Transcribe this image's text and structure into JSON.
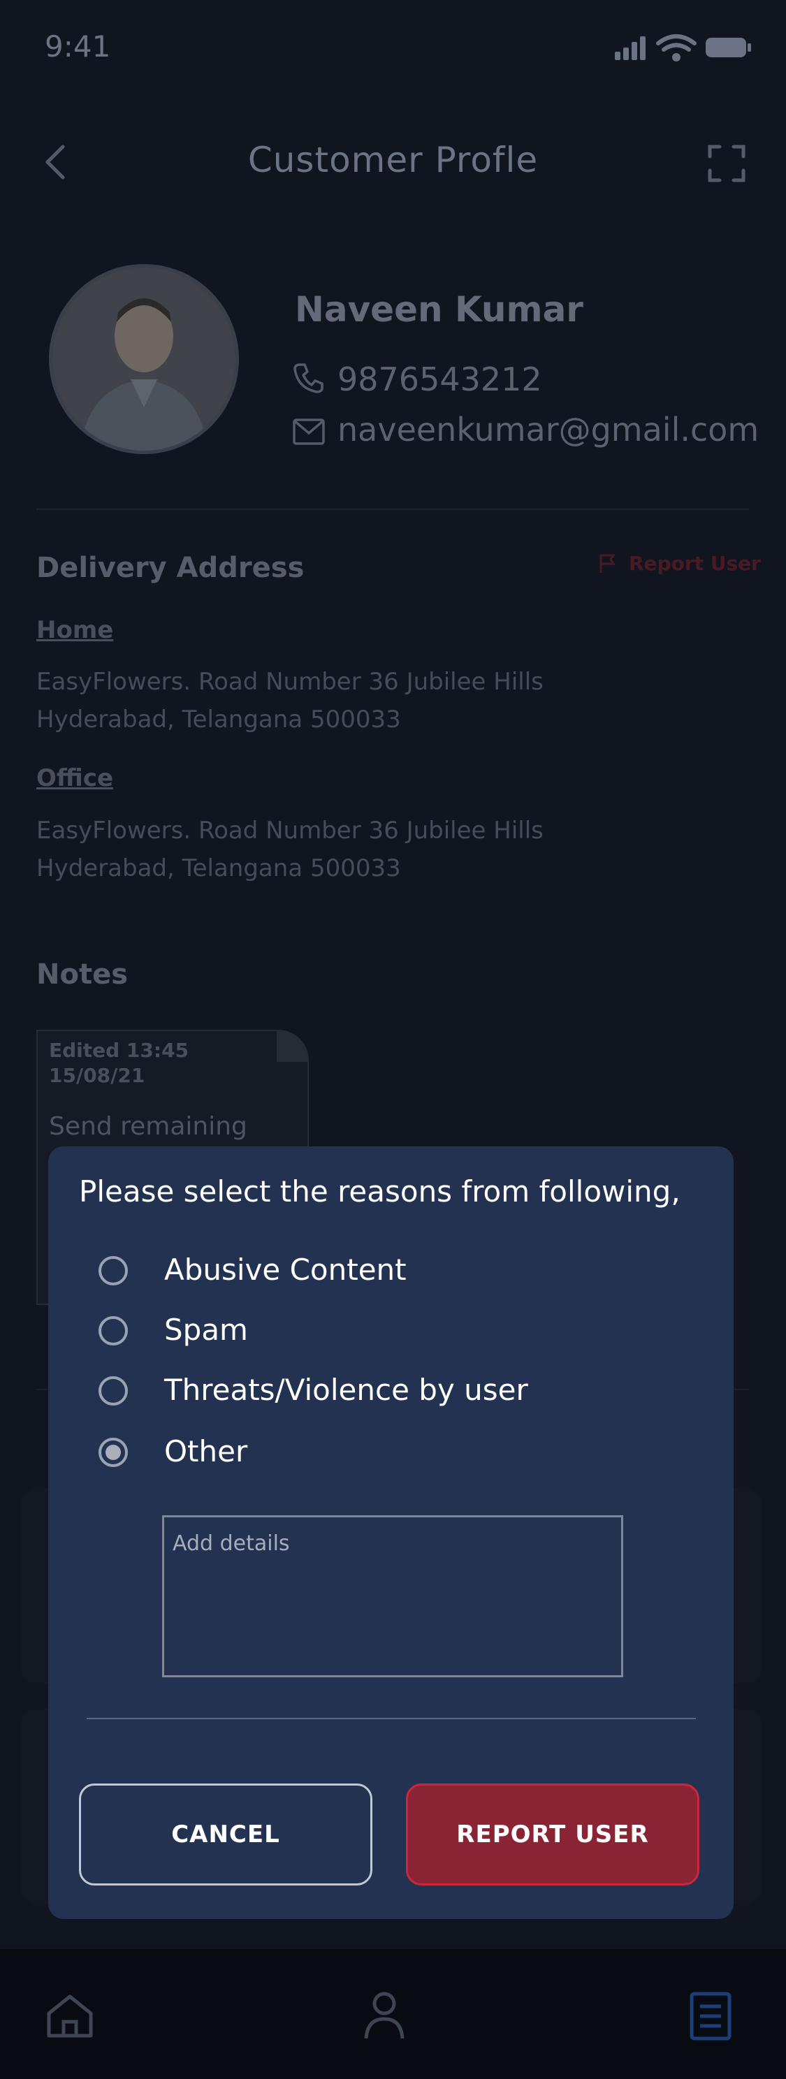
{
  "status_bar": {
    "time": "9:41"
  },
  "header": {
    "title": "Customer Profle"
  },
  "customer": {
    "name": "Naveen Kumar",
    "phone": "9876543212",
    "email": "naveenkumar@gmail.com"
  },
  "delivery": {
    "heading": "Delivery Address",
    "report_link": "Report User",
    "addresses": [
      {
        "label": "Home",
        "line1": "EasyFlowers. Road Number 36 Jubilee Hills",
        "line2": "Hyderabad, Telangana 500033"
      },
      {
        "label": "Office",
        "line1": "EasyFlowers. Road Number 36 Jubilee Hills",
        "line2": "Hyderabad, Telangana 500033"
      }
    ]
  },
  "notes": {
    "heading": "Notes",
    "card": {
      "edited_line1": "Edited 13:45",
      "edited_line2": "15/08/21",
      "text": "Send remaining"
    }
  },
  "dialog": {
    "title": "Please select the reasons from following,",
    "options": [
      {
        "label": "Abusive Content",
        "selected": false
      },
      {
        "label": "Spam",
        "selected": false
      },
      {
        "label": "Threats/Violence by user",
        "selected": false
      },
      {
        "label": "Other",
        "selected": true
      }
    ],
    "details_placeholder": "Add details",
    "cancel_label": "CANCEL",
    "report_label": "REPORT USER"
  },
  "colors": {
    "dialog_bg": "#233250",
    "report_button": "#8a2434",
    "report_border": "#c8273d",
    "overlay": "#0a0d16"
  },
  "icons": [
    "back-icon",
    "expand-icon",
    "phone-icon",
    "mail-icon",
    "flag-icon",
    "home-icon",
    "profile-icon",
    "orders-icon",
    "signal-icon",
    "wifi-icon",
    "battery-icon"
  ]
}
